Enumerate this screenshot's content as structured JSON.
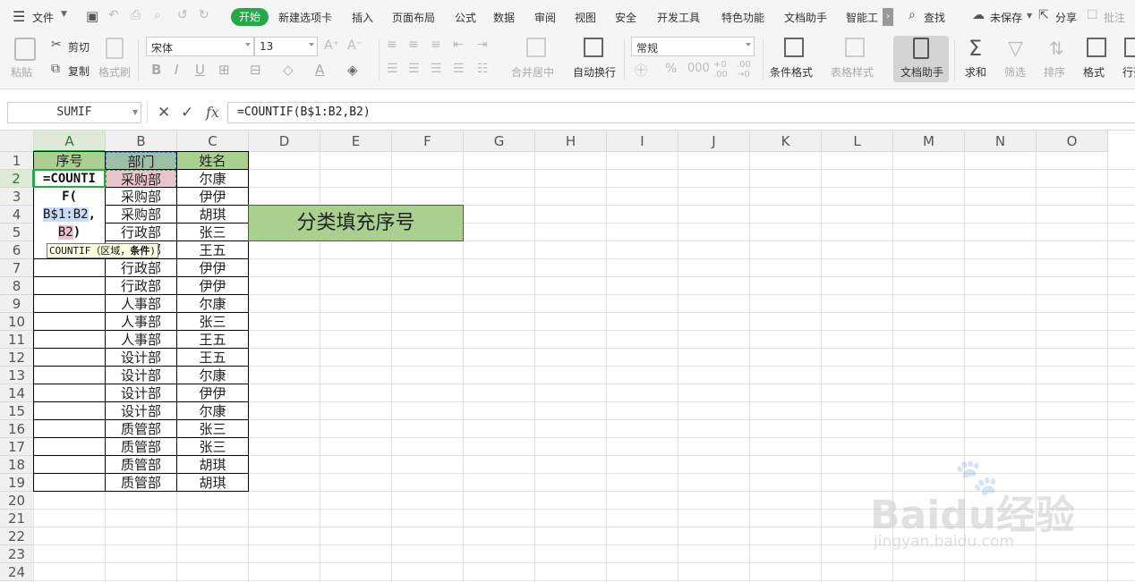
{
  "menu": {
    "file_label": "文件",
    "tabs": [
      "开始",
      "新建选项卡",
      "插入",
      "页面布局",
      "公式",
      "数据",
      "审阅",
      "视图",
      "安全",
      "开发工具",
      "特色功能",
      "文档助手",
      "智能工"
    ],
    "search_label": "查找",
    "unsaved_label": "未保存",
    "share_label": "分享",
    "comment_label": "批注"
  },
  "ribbon": {
    "paste": "粘贴",
    "cut": "剪切",
    "copy": "复制",
    "format_painter": "格式刷",
    "font_name": "宋体",
    "font_size": "13",
    "merge_center": "合并居中",
    "wrap_text": "自动换行",
    "number_format": "常规",
    "conditional_format": "条件格式",
    "table_style": "表格样式",
    "doc_assistant": "文档助手",
    "sum": "求和",
    "filter": "筛选",
    "sort": "排序",
    "format": "格式",
    "rows_cols": "行列"
  },
  "formula_bar": {
    "name_box": "SUMIF",
    "fx": "fx",
    "formula": "=COUNTIF(B$1:B2,B2)"
  },
  "columns": [
    "A",
    "B",
    "C",
    "D",
    "E",
    "F",
    "G",
    "H",
    "I",
    "J",
    "K",
    "L",
    "M",
    "N",
    "O"
  ],
  "rows": [
    "1",
    "2",
    "3",
    "4",
    "5",
    "6",
    "7",
    "8",
    "9",
    "10",
    "11",
    "12",
    "13",
    "14",
    "15",
    "16",
    "17",
    "18",
    "19",
    "20",
    "21",
    "22",
    "23",
    "24"
  ],
  "header_row": {
    "a": "序号",
    "b": "部门",
    "c": "姓名"
  },
  "departments": [
    "采购部",
    "采购部",
    "采购部",
    "行政部",
    "行政部",
    "行政部",
    "行政部",
    "人事部",
    "人事部",
    "人事部",
    "设计部",
    "设计部",
    "设计部",
    "设计部",
    "质管部",
    "质管部",
    "质管部",
    "质管部"
  ],
  "names": [
    "尔康",
    "伊伊",
    "胡琪",
    "张三",
    "王五",
    "伊伊",
    "伊伊",
    "尔康",
    "张三",
    "王五",
    "王五",
    "尔康",
    "伊伊",
    "尔康",
    "张三",
    "张三",
    "胡琪",
    "胡琪"
  ],
  "edit_cell": {
    "line1": "=COUNTI",
    "line2": "F(",
    "line3_ref": "B$1:B2",
    "line3_comma": ",",
    "line4_ref": "B2",
    "line4_paren": ")"
  },
  "tooltip": {
    "fn": "COUNTIF",
    "args": "（区域，",
    "bold_arg": "条件",
    "close": ")"
  },
  "banner": "分类填充序号",
  "watermark": {
    "main": "Baidu经验",
    "sub": "jingyan.baidu.com"
  },
  "colors": {
    "header_green": "#a9d08e",
    "active_green": "#26a74a",
    "banner_green": "#a9d08e",
    "ref_blue": "#c9dcf5",
    "ref_pink": "#e8c4cc"
  }
}
